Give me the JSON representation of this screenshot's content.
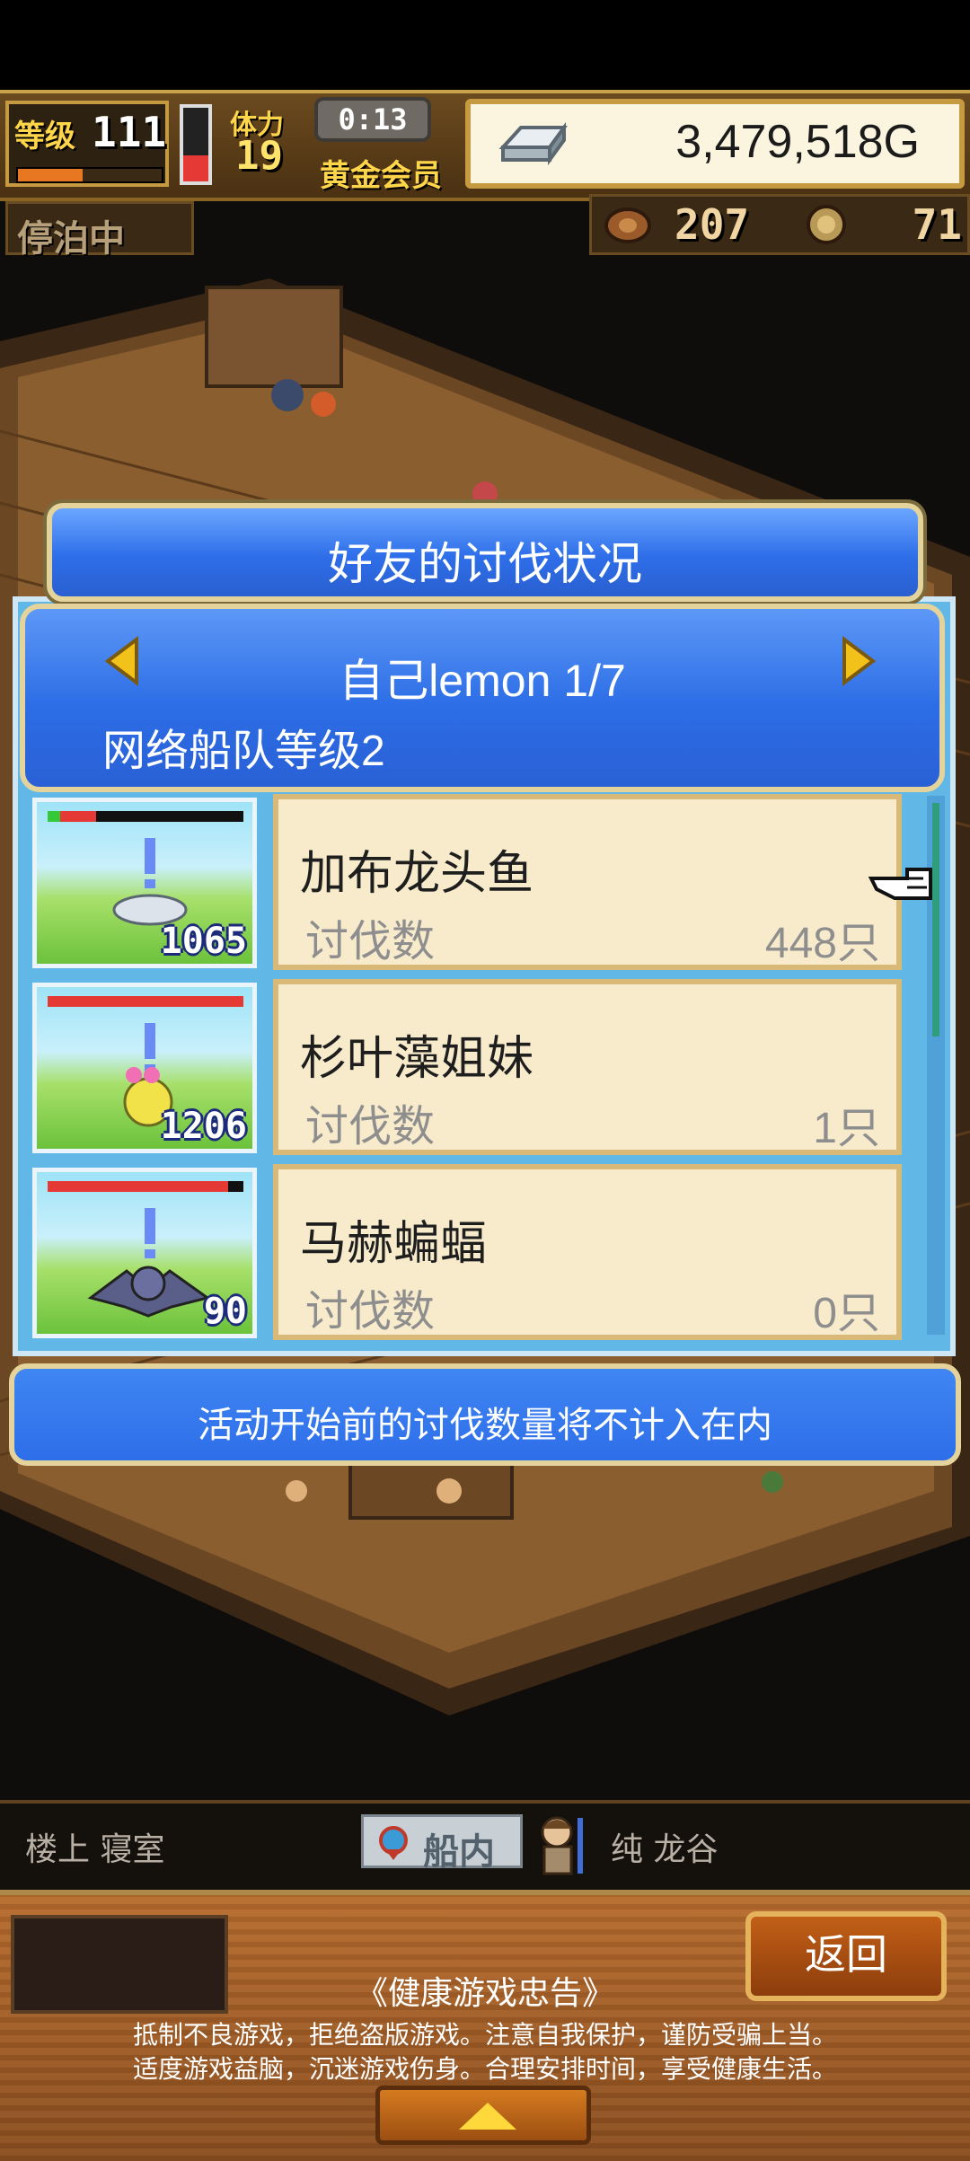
{
  "hud": {
    "level_label": "等级",
    "level_value": "111",
    "level_progress": 0.45,
    "stamina_label": "体力",
    "stamina_value": "19",
    "stamina_fill": 0.35,
    "timer": "0:13",
    "member_label": "黄金会员",
    "gold_value": "3,479,518G",
    "anchor_status": "停泊中",
    "resource1_value": "207",
    "resource2_value": "71"
  },
  "dialog": {
    "title": "好友的讨伐状况",
    "friend_name": "自己lemon 1/7",
    "fleet_level": "网络船队等级2",
    "notice": "活动开始前的讨伐数量将不计入在内",
    "monsters": [
      {
        "name": "加布龙头鱼",
        "kill_label": "讨伐数",
        "kill_value": "448只",
        "count": "1065",
        "hp_ratio": 0.2
      },
      {
        "name": "杉叶藻姐妹",
        "kill_label": "讨伐数",
        "kill_value": "1只",
        "count": "1206",
        "hp_ratio": 1.0
      },
      {
        "name": "马赫蝙蝠",
        "kill_label": "讨伐数",
        "kill_value": "0只",
        "count": "90",
        "hp_ratio": 0.92
      }
    ]
  },
  "location": {
    "left": "楼上 寝室",
    "ship_tab": "船内",
    "right": "纯 龙谷"
  },
  "footer": {
    "back_label": "返回",
    "advisory_title": "《健康游戏忠告》",
    "advisory_line1": "抵制不良游戏，拒绝盗版游戏。注意自我保护，谨防受骗上当。",
    "advisory_line2": "适度游戏益脑，沉迷游戏伤身。合理安排时间，享受健康生活。"
  }
}
